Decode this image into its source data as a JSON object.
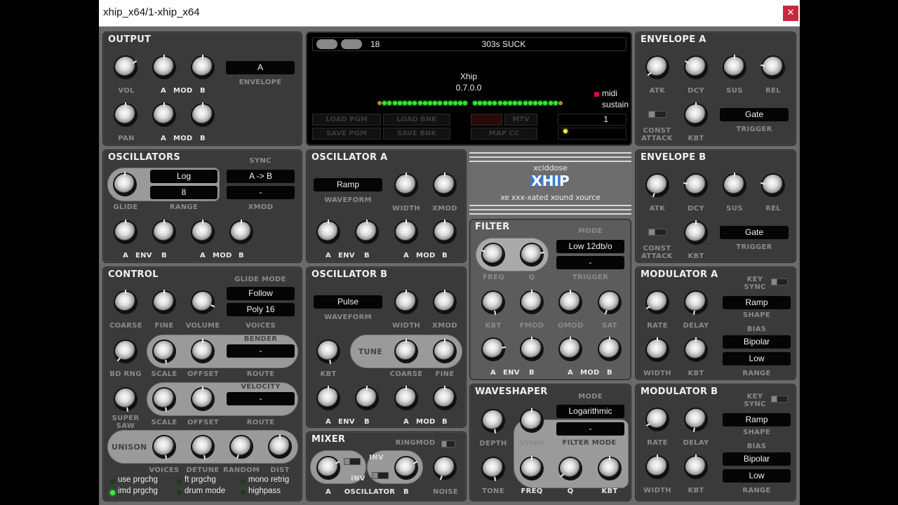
{
  "window": {
    "title": "xhip_x64/1-xhip_x64",
    "close_icon": "close-icon"
  },
  "output": {
    "title": "OUTPUT",
    "vol": "VOL",
    "pan": "PAN",
    "a": "A",
    "mod": "MOD",
    "b": "B",
    "envelope_value": "A",
    "envelope_label": "ENVELOPE"
  },
  "preset": {
    "number": "18",
    "name": "303s SUCK",
    "app_name": "Xhip",
    "version": "0.7.0.0",
    "midi": "midi",
    "sustain": "sustain",
    "channel": "1",
    "buttons": {
      "load_pgm": "LOAD PGM",
      "load_bnk": "LOAD BNK",
      "save_pgm": "SAVE PGM",
      "save_bnk": "SAVE BNK",
      "mtv": "MTV",
      "map_cc": "MAP CC"
    }
  },
  "envelope_a": {
    "title": "ENVELOPE A",
    "atk": "ATK",
    "dcy": "DCY",
    "sus": "SUS",
    "rel": "REL",
    "const": "CONST",
    "attack": "ATTACK",
    "kbt": "KBT",
    "trigger_value": "Gate",
    "trigger": "TRIGGER"
  },
  "envelope_b": {
    "title": "ENVELOPE B",
    "atk": "ATK",
    "dcy": "DCY",
    "sus": "SUS",
    "rel": "REL",
    "const": "CONST",
    "attack": "ATTACK",
    "kbt": "KBT",
    "trigger_value": "Gate",
    "trigger": "TRIGGER"
  },
  "oscillators": {
    "title": "OSCILLATORS",
    "sync": "SYNC",
    "glide_mode": "Log",
    "range_value": "8",
    "sync_value": "A -> B",
    "xmod_value": "-",
    "glide": "GLIDE",
    "range": "RANGE",
    "xmod": "XMOD",
    "a": "A",
    "env": "ENV",
    "b": "B",
    "mod": "MOD"
  },
  "osc_a": {
    "title": "OSCILLATOR A",
    "waveform_value": "Ramp",
    "waveform": "WAVEFORM",
    "width": "WIDTH",
    "xmod": "XMOD",
    "a": "A",
    "env": "ENV",
    "b": "B",
    "mod": "MOD"
  },
  "osc_b": {
    "title": "OSCILLATOR B",
    "waveform_value": "Pulse",
    "waveform": "WAVEFORM",
    "width": "WIDTH",
    "xmod": "XMOD",
    "tune": "TUNE",
    "kbt": "KBT",
    "coarse": "COARSE",
    "fine": "FINE",
    "a": "A",
    "env": "ENV",
    "b": "B",
    "mod": "MOD"
  },
  "logo": {
    "brand": "xciddose",
    "name": "XHIP",
    "tagline": "xe xxx-xated xound xource"
  },
  "filter": {
    "title": "FILTER",
    "mode": "MODE",
    "mode_value": "Low 12db/o",
    "trigger_value": "-",
    "freq": "FREQ",
    "q": "Q",
    "trigger": "TRIGGER",
    "kbt": "KBT",
    "fmod": "FMOD",
    "qmod": "QMOD",
    "sat": "SAT",
    "a": "A",
    "env": "ENV",
    "b": "B",
    "mod": "MOD"
  },
  "control": {
    "title": "CONTROL",
    "glide_mode": "GLIDE MODE",
    "glide_value": "Follow",
    "voices_value": "Poly 16",
    "coarse": "COARSE",
    "fine": "FINE",
    "volume": "VOLUME",
    "voices": "VOICES",
    "bender": "BENDER",
    "bender_route": "-",
    "bd_rng": "BD RNG",
    "scale": "SCALE",
    "offset": "OFFSET",
    "route": "ROUTE",
    "velocity": "VELOCITY",
    "velocity_route": "-",
    "super": "SUPER",
    "saw": "SAW",
    "unison": "UNISON",
    "u_voices": "VOICES",
    "detune": "DETUNE",
    "random": "RANDOM",
    "dist": "DIST",
    "options": [
      {
        "label": "use prgchg",
        "on": false
      },
      {
        "label": "ft prgchg",
        "on": false
      },
      {
        "label": "mono retrig",
        "on": false
      },
      {
        "label": "imd prgchg",
        "on": true
      },
      {
        "label": "drum mode",
        "on": false
      },
      {
        "label": "highpass",
        "on": false
      }
    ]
  },
  "mixer": {
    "title": "MIXER",
    "ringmod": "RINGMOD",
    "inv": "INV",
    "a": "A",
    "oscillator": "OSCILLATOR",
    "b": "B",
    "noise": "NOISE"
  },
  "waveshaper": {
    "title": "WAVESHAPER",
    "mode": "MODE",
    "mode_value": "Logarithmic",
    "filter_mode_value": "-",
    "depth": "DEPTH",
    "symm": "SYMM",
    "filter_mode": "FILTER MODE",
    "tone": "TONE",
    "freq": "FREQ",
    "q": "Q",
    "kbt": "KBT"
  },
  "mod_a": {
    "title": "MODULATOR A",
    "key": "KEY",
    "sync": "SYNC",
    "shape_value": "Ramp",
    "shape": "SHAPE",
    "bias": "BIAS",
    "bias_value": "Bipolar",
    "range_value": "Low",
    "range": "RANGE",
    "rate": "RATE",
    "delay": "DELAY",
    "width": "WIDTH",
    "kbt": "KBT"
  },
  "mod_b": {
    "title": "MODULATOR B",
    "key": "KEY",
    "sync": "SYNC",
    "shape_value": "Ramp",
    "shape": "SHAPE",
    "bias": "BIAS",
    "bias_value": "Bipolar",
    "range_value": "Low",
    "range": "RANGE",
    "rate": "RATE",
    "delay": "DELAY",
    "width": "WIDTH",
    "kbt": "KBT"
  }
}
